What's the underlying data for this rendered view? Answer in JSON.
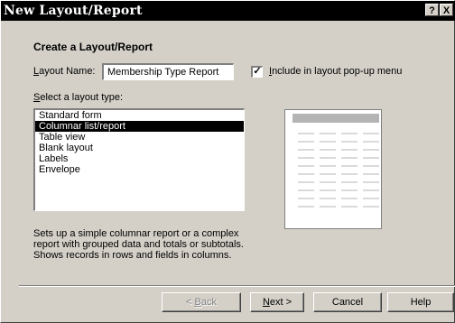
{
  "window": {
    "title": "New Layout/Report",
    "help_button": "?",
    "close_button": "X"
  },
  "section_heading": "Create a Layout/Report",
  "layout_name": {
    "label_prefix": "L",
    "label_rest": "ayout Name:",
    "value": "Membership Type Report"
  },
  "include_popup": {
    "checked": true,
    "check_mark": "✓",
    "label_prefix": "I",
    "label_rest": "nclude in layout pop-up menu"
  },
  "layout_type": {
    "label_prefix": "S",
    "label_rest": "elect a layout type:",
    "items": [
      "Standard form",
      "Columnar list/report",
      "Table view",
      "Blank layout",
      "Labels",
      "Envelope"
    ],
    "selected_index": 1
  },
  "description": "Sets up a simple columnar report or a complex report with grouped data and totals or subtotals. Shows records in rows and fields in columns.",
  "buttons": {
    "back_prefix": "< ",
    "back_underlined": "B",
    "back_rest": "ack",
    "next_underlined": "N",
    "next_rest": "ext >",
    "cancel": "Cancel",
    "help": "Help"
  },
  "colors": {
    "dialog_bg": "#d4d0c8",
    "title_bar": "#000000",
    "selection": "#000000",
    "preview_header": "#b4b4b4",
    "preview_lines": "#b4b4b4"
  }
}
